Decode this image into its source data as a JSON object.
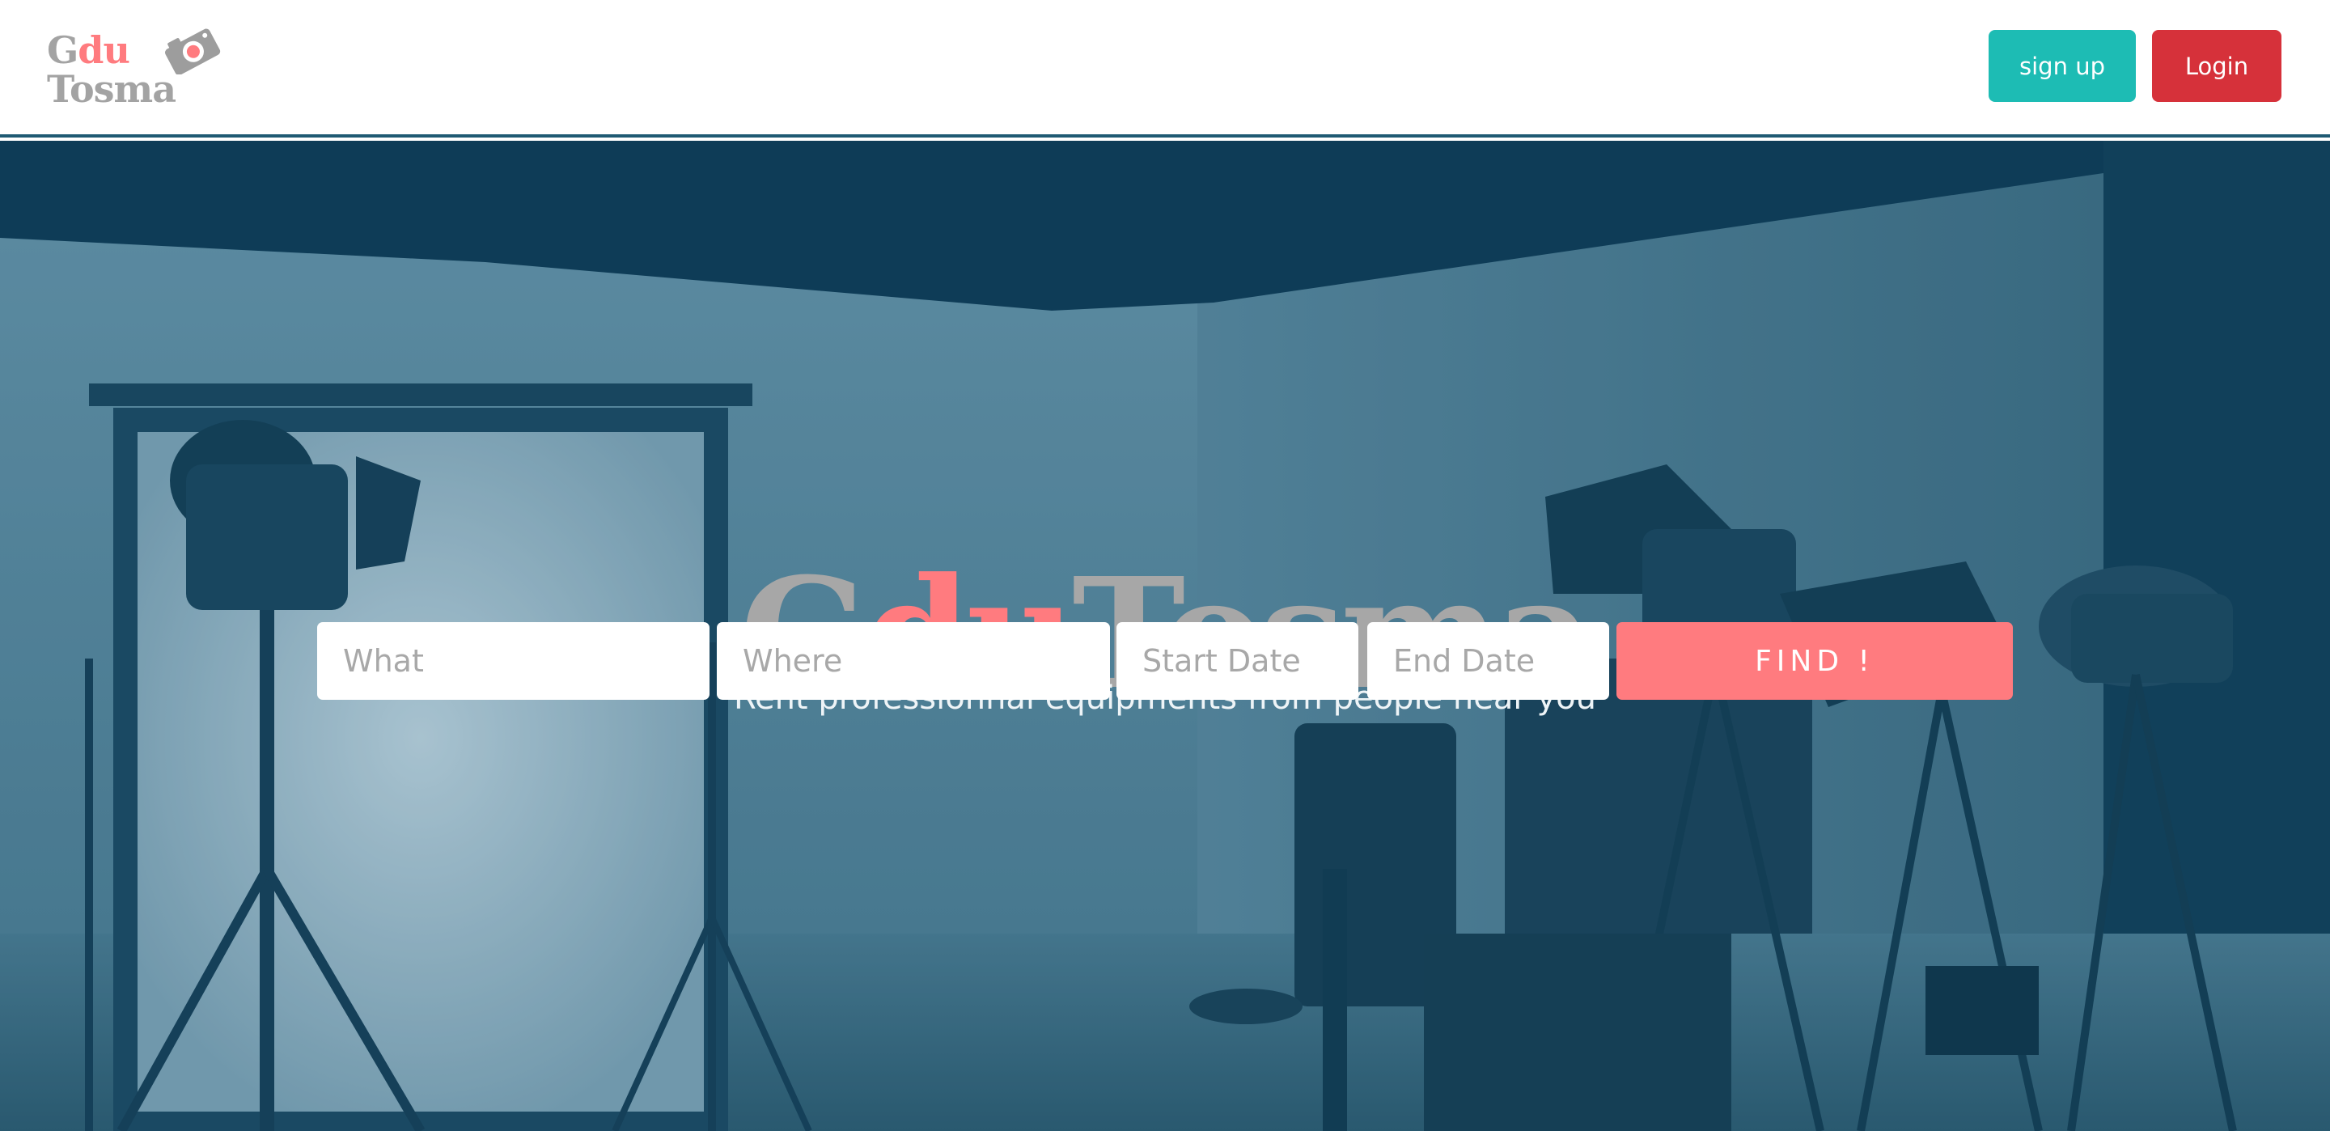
{
  "header": {
    "logo": {
      "line1_plain": "G",
      "line1_accent": "du",
      "line2": "Tosma"
    },
    "signup_label": "sign up",
    "login_label": "Login"
  },
  "hero": {
    "title_plain_1": "G",
    "title_accent": "du",
    "title_plain_2": "Tosma",
    "subtitle": "Rent professionnal equipments from people near you",
    "background": "photo-studio-with-lights"
  },
  "search": {
    "what_placeholder": "What",
    "where_placeholder": "Where",
    "start_placeholder": "Start Date",
    "end_placeholder": "End Date",
    "find_label": "FIND !"
  },
  "colors": {
    "brand_accent": "#ff7b7f",
    "brand_gray": "#a7a7a7",
    "signup": "#1dbcb4",
    "login": "#d6313a"
  },
  "icons": {
    "logo_mark": "camera-icon"
  }
}
